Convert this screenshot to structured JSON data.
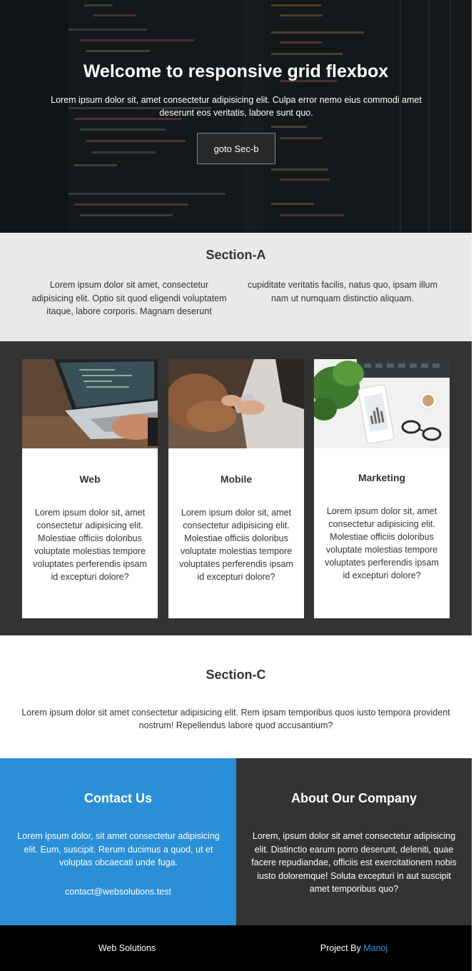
{
  "hero": {
    "title": "Welcome to responsive grid flexbox",
    "text": "Lorem ipsum dolor sit, amet consectetur adipisicing elit. Culpa error nemo eius commodi amet deserunt eos veritatis, labore sunt quo.",
    "button_label": "goto Sec-b"
  },
  "section_a": {
    "title": "Section-A",
    "col1": "Lorem ipsum dolor sit amet, consectetur adipisicing elit. Optio sit quod eligendi voluptatem itaque, labore corporis. Magnam deserunt",
    "col2": "cupiditate veritatis facilis, natus quo, ipsam illum nam ut numquam distinctio aliquam."
  },
  "cards": [
    {
      "title": "Web",
      "text": "Lorem ipsum dolor sit, amet consectetur adipisicing elit. Molestiae officiis doloribus voluptate molestias tempore voluptates perferendis ipsam id excepturi dolore?"
    },
    {
      "title": "Mobile",
      "text": "Lorem ipsum dolor sit, amet consectetur adipisicing elit. Molestiae officiis doloribus voluptate molestias tempore voluptates perferendis ipsam id excepturi dolore?"
    },
    {
      "title": "Marketing",
      "text": "Lorem ipsum dolor sit, amet consectetur adipisicing elit. Molestiae officiis doloribus voluptate molestias tempore voluptates perferendis ipsam id excepturi dolore?"
    }
  ],
  "section_c": {
    "title": "Section-C",
    "text": "Lorem ipsum dolor sit amet consectetur adipisicing elit. Rem ipsam temporibus quos iusto tempora provident nostrum! Repellendus labore quod accusantium?"
  },
  "contact": {
    "title": "Contact Us",
    "text": "Lorem ipsum dolor, sit amet consectetur adipisicing elit. Eum, suscipit. Rerum ducimus a quod, ut et voluptas obcaecati unde fuga.",
    "email": "contact@websolutions.test"
  },
  "about": {
    "title": "About Our Company",
    "text": "Lorem, ipsum dolor sit amet consectetur adipisicing elit. Distinctio earum porro deserunt, deleniti, quae facere repudiandae, officiis est exercitationem nobis iusto doloremque! Soluta excepturi in aut suscipit amet temporibus quo?"
  },
  "footer": {
    "brand": "Web Solutions",
    "credit_prefix": "Project By",
    "credit_name": "Manoj"
  },
  "colors": {
    "accent_blue": "#2a8fd6",
    "dark": "#333333",
    "light_gray": "#e9e9e9",
    "footer_link": "#3b95e0"
  }
}
